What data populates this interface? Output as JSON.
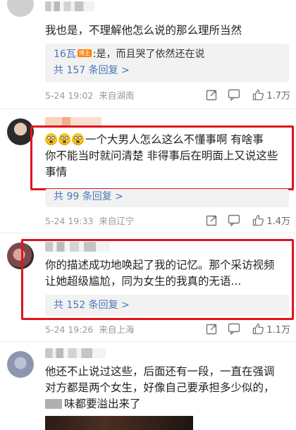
{
  "comments": [
    {
      "text": "我也是，不理解他怎么说的那么理所当然",
      "reply": {
        "author": "16瓦",
        "badge": "博主",
        "text": ":是，而且哭了依然还在说"
      },
      "reply_count": "共 157 条回复 >",
      "date": "5-24 19:02",
      "location": "来自湖南",
      "likes": "1.7万"
    },
    {
      "text_lines": [
        "一个大男人怎么这么不懂事啊 有啥事",
        "你不能当时就问清楚 非得事后在明面上又说这些",
        "事情"
      ],
      "reply_count": "共 99 条回复 >",
      "date": "5-24 19:33",
      "location": "来自辽宁",
      "likes": "1.4万"
    },
    {
      "text_lines": [
        "你的描述成功地唤起了我的记忆。那个采访视频",
        "让她超级尴尬，同为女生的我真的无语..."
      ],
      "reply_count": "共 152 条回复 >",
      "date": "5-24 19:26",
      "location": "来自上海",
      "likes": "1.1万"
    },
    {
      "text_lines": [
        "他还不止说过这些，后面还有一段，一直在强调",
        "对方都是两个女生，好像自己要承担多少似的，",
        "味都要溢出来了"
      ]
    }
  ],
  "colors": {
    "highlight": "#e0141e",
    "link": "#4a78b5",
    "badge": "#ff8200"
  },
  "icons": [
    "share-icon",
    "comment-icon",
    "like-icon",
    "flushed-emoji-icon"
  ]
}
